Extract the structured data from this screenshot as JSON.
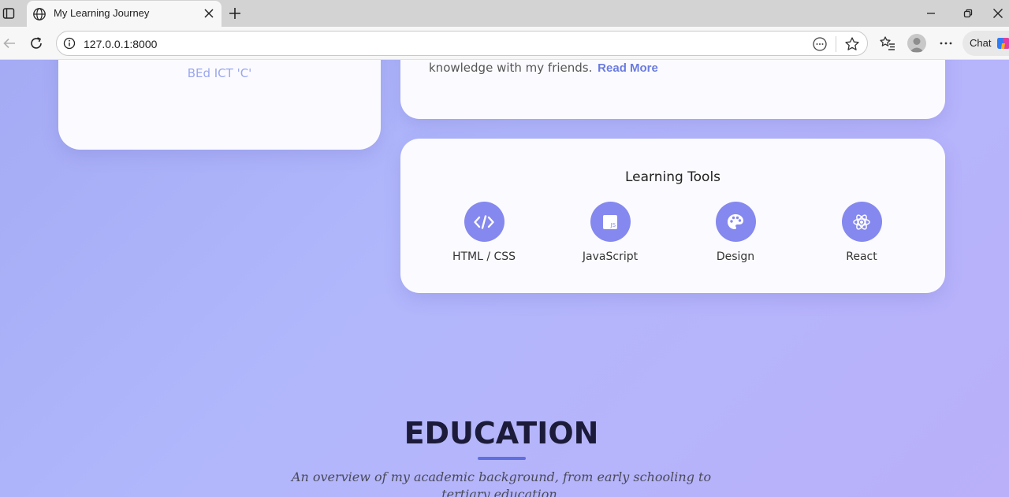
{
  "browser": {
    "tab_title": "My Learning Journey",
    "url": "127.0.0.1:8000",
    "chat_label": "Chat"
  },
  "profile": {
    "subtitle": "BEd ICT 'C'"
  },
  "about": {
    "text": "knowledge with my friends.",
    "read_more": "Read More"
  },
  "tools": {
    "title": "Learning Tools",
    "items": [
      {
        "label": "HTML / CSS",
        "icon": "code-icon"
      },
      {
        "label": "JavaScript",
        "icon": "js-icon"
      },
      {
        "label": "Design",
        "icon": "palette-icon"
      },
      {
        "label": "React",
        "icon": "atom-icon"
      }
    ]
  },
  "education": {
    "title": "EDUCATION",
    "subtitle": "An overview of my academic background, from early schooling to tertiary education."
  },
  "colors": {
    "accent": "#8588ef",
    "link": "#6a7be0",
    "underline": "#5f6fe0"
  }
}
